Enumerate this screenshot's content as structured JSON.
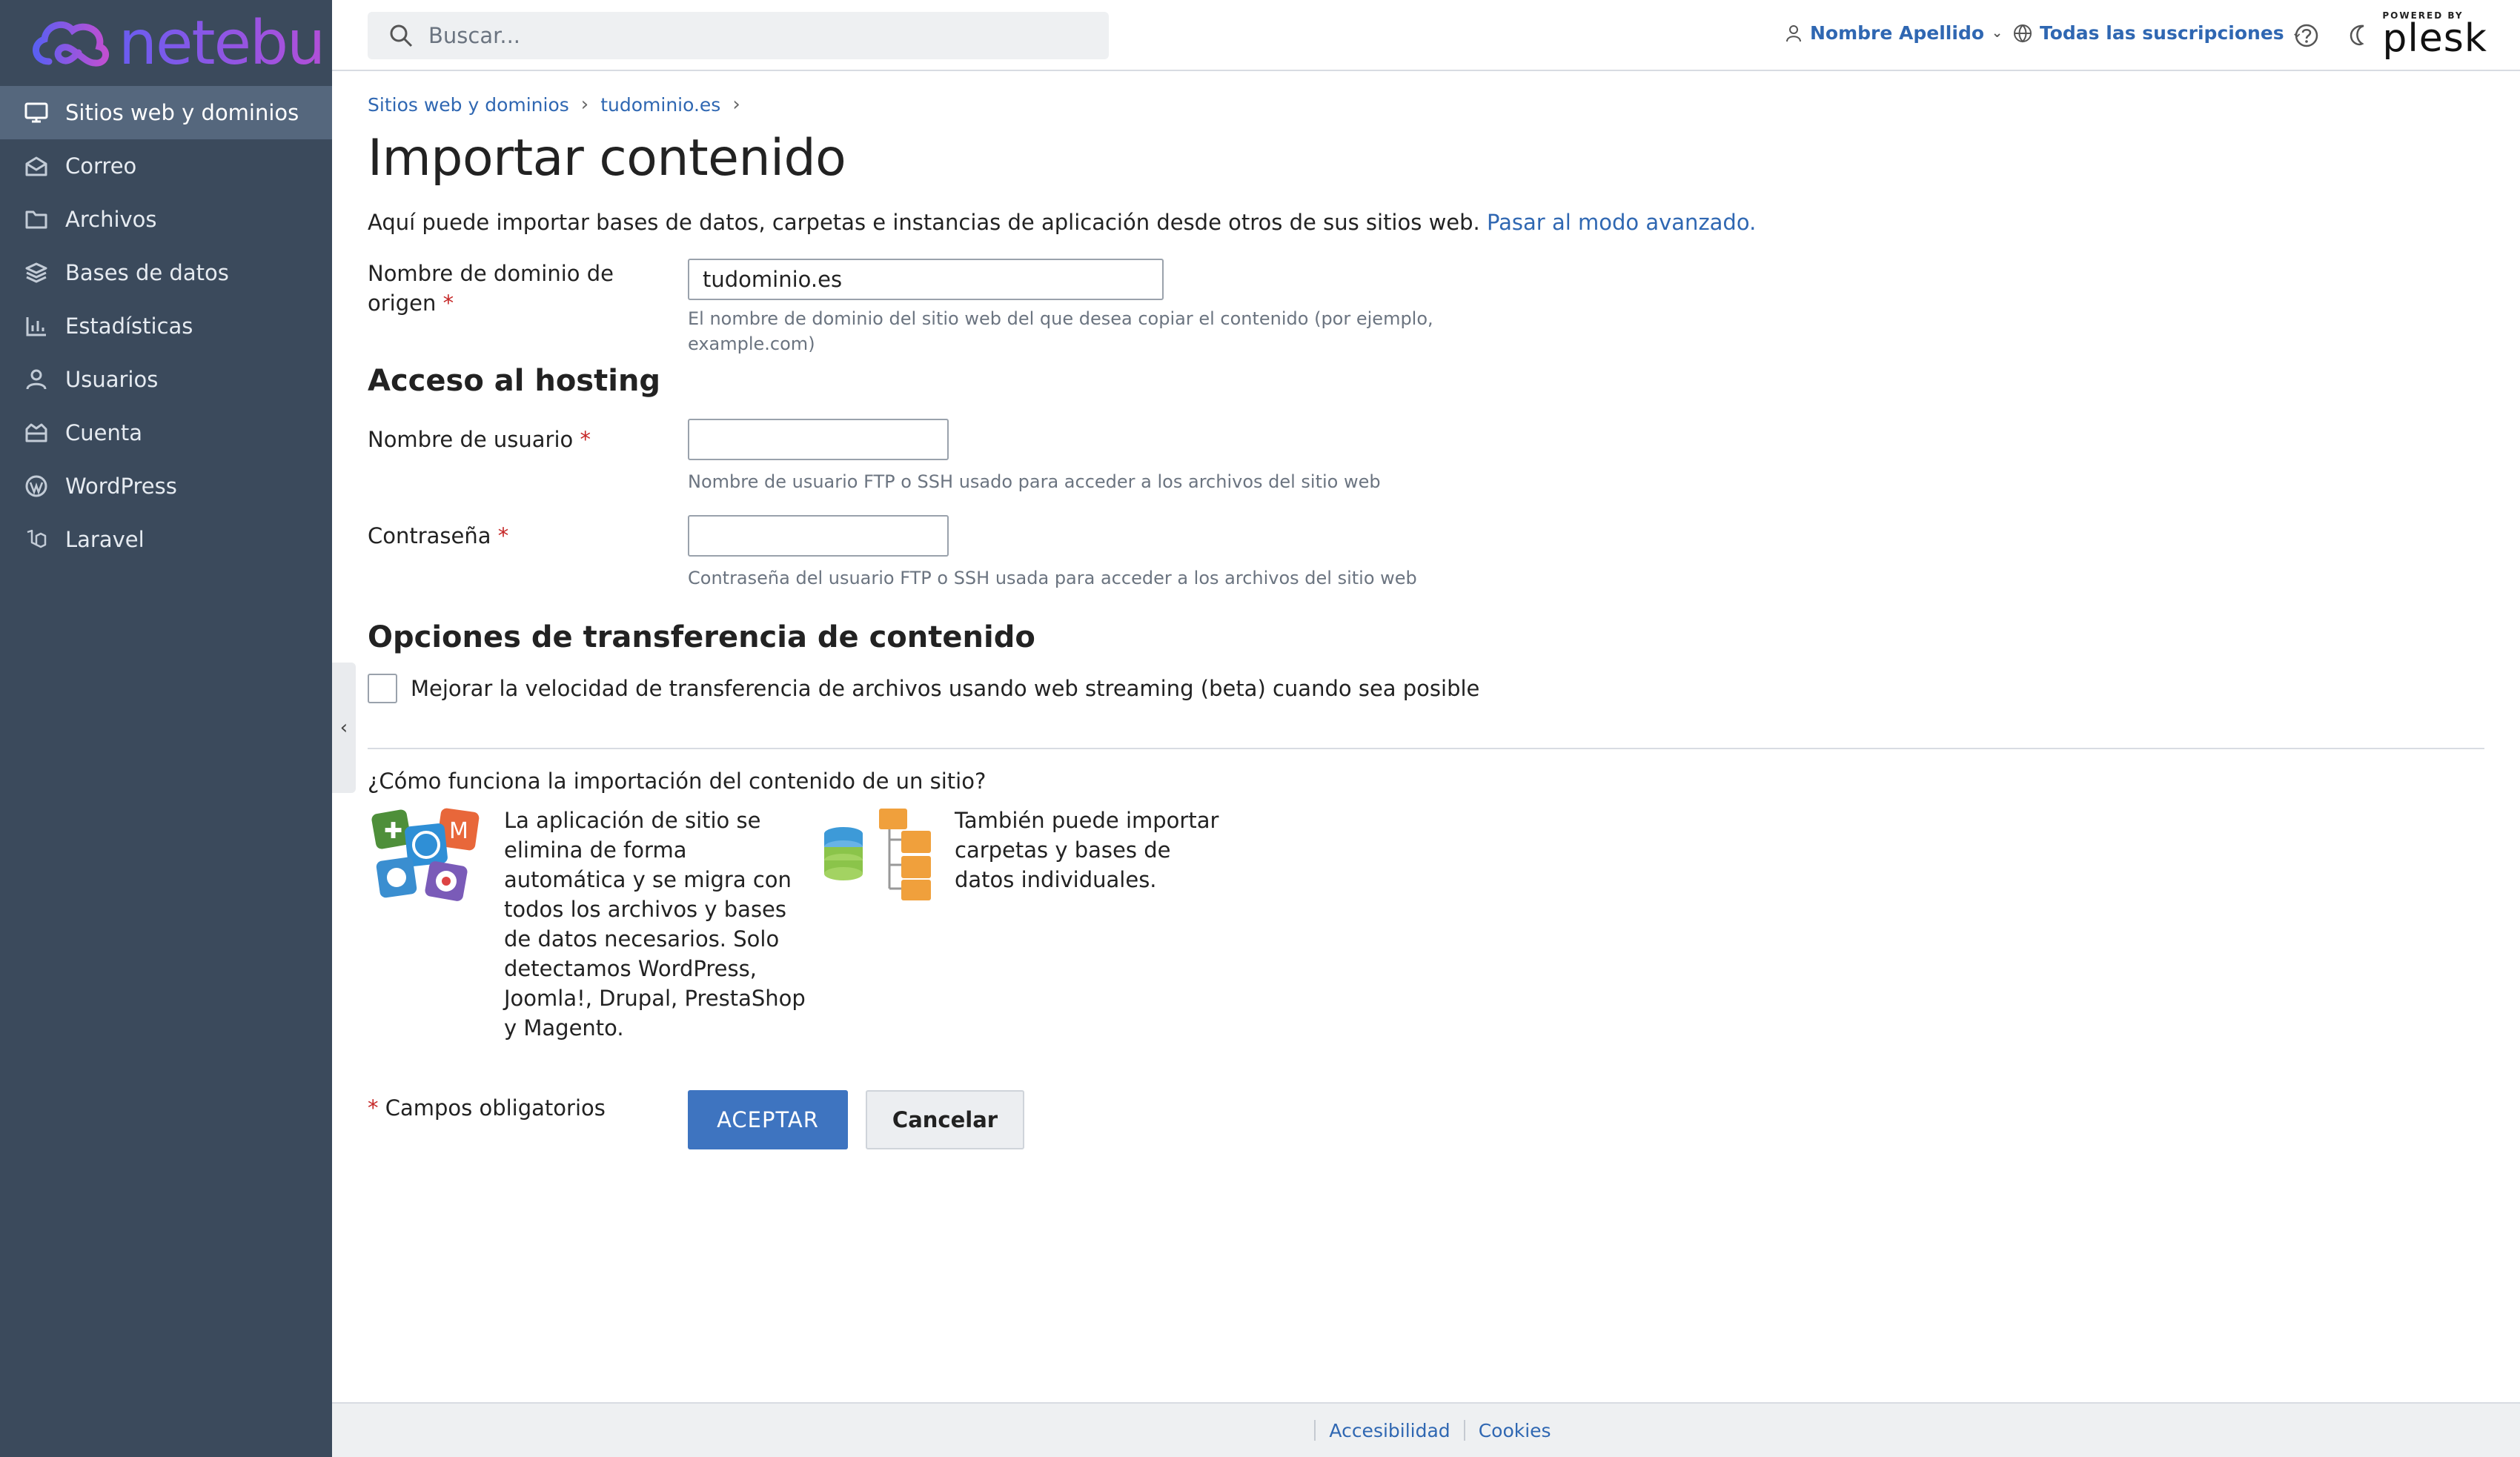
{
  "brand": {
    "name": "netebu"
  },
  "sidebar": {
    "items": [
      {
        "label": "Sitios web y dominios",
        "icon": "monitor-icon"
      },
      {
        "label": "Correo",
        "icon": "mail-icon"
      },
      {
        "label": "Archivos",
        "icon": "folder-icon"
      },
      {
        "label": "Bases de datos",
        "icon": "database-icon"
      },
      {
        "label": "Estadísticas",
        "icon": "bar-chart-icon"
      },
      {
        "label": "Usuarios",
        "icon": "user-icon"
      },
      {
        "label": "Cuenta",
        "icon": "account-icon"
      },
      {
        "label": "WordPress",
        "icon": "wordpress-icon"
      },
      {
        "label": "Laravel",
        "icon": "laravel-icon"
      }
    ]
  },
  "header": {
    "search_placeholder": "Buscar...",
    "user_name": "Nombre Apellido",
    "subscriptions": "Todas las suscripciones",
    "powered_by": "POWERED BY",
    "plesk": "plesk"
  },
  "breadcrumb": [
    "Sitios web y dominios",
    "tudominio.es"
  ],
  "page": {
    "title": "Importar contenido",
    "intro": "Aquí puede importar bases de datos, carpetas e instancias de aplicación desde otros de sus sitios web.",
    "advanced_link": "Pasar al modo avanzado."
  },
  "form": {
    "domain_label_1": "Nombre de dominio de",
    "domain_label_2": "origen",
    "required_mark": "*",
    "domain_value": "tudominio.es",
    "domain_hint_1": "El nombre de dominio del sitio web del que desea copiar el contenido (por ejemplo,",
    "domain_hint_2": "example.com)",
    "hosting_section": "Acceso al hosting",
    "username_label": "Nombre de usuario",
    "username_value": "",
    "username_hint": "Nombre de usuario FTP o SSH usado para acceder a los archivos del sitio web",
    "password_label": "Contraseña",
    "password_value": "",
    "password_hint": "Contraseña del usuario FTP o SSH usada para acceder a los archivos del sitio web",
    "transfer_section": "Opciones de transferencia de contenido",
    "streaming_label": "Mejorar la velocidad de transferencia de archivos usando web streaming (beta) cuando sea posible",
    "streaming_checked": false
  },
  "howto": {
    "title": "¿Cómo funciona la importación del contenido de un sitio?",
    "app_text": "La aplicación de sitio se elimina de forma automática y se migra con todos los archivos y bases de datos necesarios. Solo detectamos WordPress, Joomla!, Drupal, PrestaShop y Magento.",
    "files_text": "También puede importar carpetas y bases de datos individuales."
  },
  "actions": {
    "required_note": "Campos obligatorios",
    "ok": "ACEPTAR",
    "cancel": "Cancelar"
  },
  "footer": {
    "accessibility": "Accesibilidad",
    "cookies": "Cookies"
  }
}
